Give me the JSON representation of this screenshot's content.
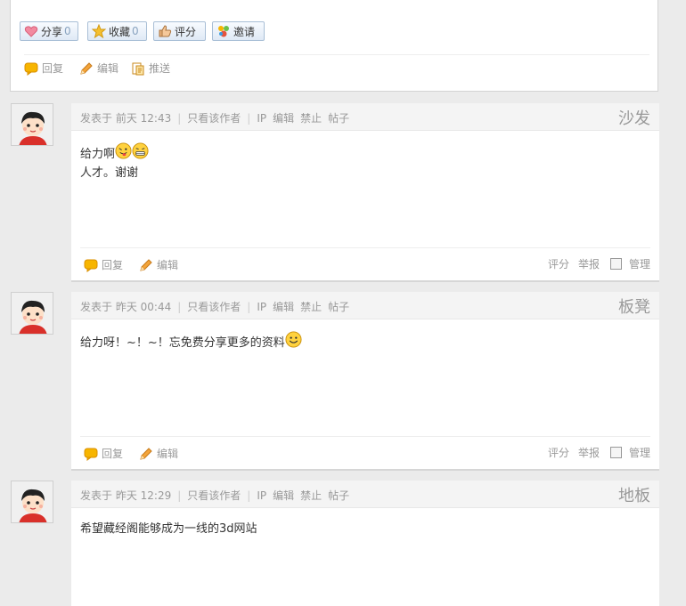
{
  "top": {
    "share_label": "分享",
    "share_count": "0",
    "fav_label": "收藏",
    "fav_count": "0",
    "rate_label": "评分",
    "invite_label": "邀请",
    "reply_label": "回复",
    "edit_label": "编辑",
    "push_label": "推送"
  },
  "posts": [
    {
      "posted": "发表于 前天 12:43",
      "only_author": "只看该作者",
      "ip": "IP",
      "edit": "编辑",
      "ban": "禁止",
      "thread": "帖子",
      "floor": "沙发",
      "line1": "给力啊",
      "line2": "人才。谢谢",
      "reply": "回复",
      "edit2": "编辑",
      "rate": "评分",
      "report": "举报",
      "manage": "管理"
    },
    {
      "posted": "发表于 昨天 00:44",
      "only_author": "只看该作者",
      "ip": "IP",
      "edit": "编辑",
      "ban": "禁止",
      "thread": "帖子",
      "floor": "板凳",
      "line1": "给力呀！~！~！忘免费分享更多的资料",
      "reply": "回复",
      "edit2": "编辑",
      "rate": "评分",
      "report": "举报",
      "manage": "管理"
    },
    {
      "posted": "发表于 昨天 12:29",
      "only_author": "只看该作者",
      "ip": "IP",
      "edit": "编辑",
      "ban": "禁止",
      "thread": "帖子",
      "floor": "地板",
      "line1": "希望藏经阁能够成为一线的3d网站"
    }
  ]
}
